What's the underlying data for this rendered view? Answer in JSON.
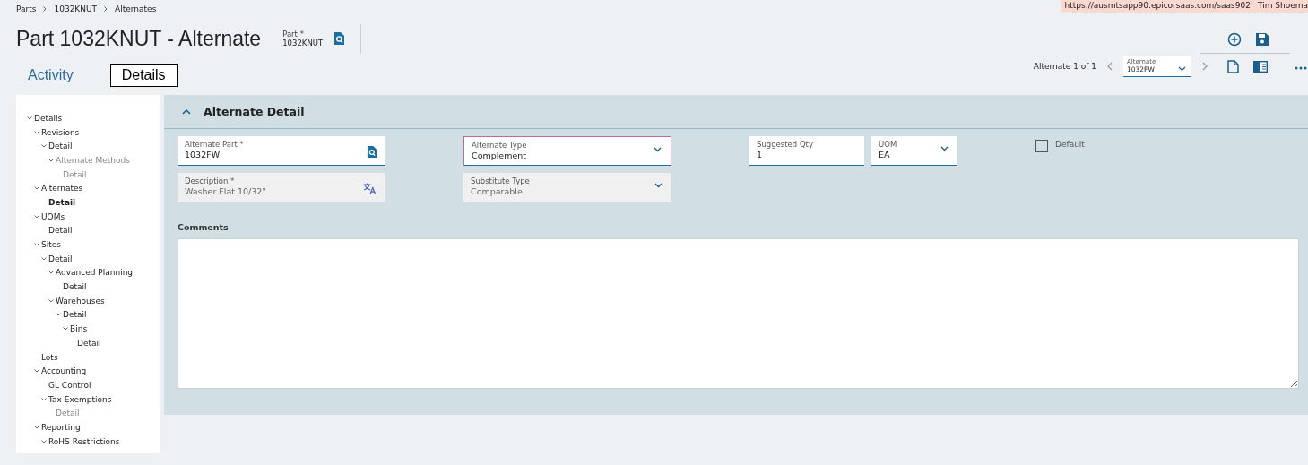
{
  "breadcrumbs": [
    "Parts",
    "1032KNUT",
    "Alternates"
  ],
  "session": {
    "url": "https://ausmtsapp90.epicorsaas.com/saas902",
    "user": "Tim Shoema"
  },
  "title": "Part 1032KNUT - Alternate",
  "part_field": {
    "label": "Part *",
    "value": "1032KNUT"
  },
  "tabs": [
    {
      "label": "Activity",
      "selected": false
    },
    {
      "label": "Details",
      "selected": true
    }
  ],
  "navigator": {
    "text": "Alternate 1 of 1",
    "field": {
      "label": "Alternate",
      "value": "1032FW"
    }
  },
  "tree": [
    {
      "label": "Details",
      "expanded": true,
      "selected": false,
      "disabled": false,
      "children": [
        {
          "label": "Revisions",
          "expanded": true,
          "selected": false,
          "disabled": false,
          "children": [
            {
              "label": "Detail",
              "expanded": true,
              "selected": false,
              "disabled": false,
              "children": [
                {
                  "label": "Alternate Methods",
                  "expanded": true,
                  "selected": false,
                  "disabled": true,
                  "children": [
                    {
                      "label": "Detail",
                      "expanded": false,
                      "selected": false,
                      "disabled": true
                    }
                  ]
                }
              ]
            }
          ]
        },
        {
          "label": "Alternates",
          "expanded": true,
          "selected": false,
          "disabled": false,
          "children": [
            {
              "label": "Detail",
              "expanded": false,
              "selected": true,
              "disabled": false
            }
          ]
        },
        {
          "label": "UOMs",
          "expanded": true,
          "selected": false,
          "disabled": false,
          "children": [
            {
              "label": "Detail",
              "expanded": false,
              "selected": false,
              "disabled": false
            }
          ]
        },
        {
          "label": "Sites",
          "expanded": true,
          "selected": false,
          "disabled": false,
          "children": [
            {
              "label": "Detail",
              "expanded": true,
              "selected": false,
              "disabled": false,
              "children": [
                {
                  "label": "Advanced Planning",
                  "expanded": true,
                  "selected": false,
                  "disabled": false,
                  "children": [
                    {
                      "label": "Detail",
                      "expanded": false,
                      "selected": false,
                      "disabled": false
                    }
                  ]
                },
                {
                  "label": "Warehouses",
                  "expanded": true,
                  "selected": false,
                  "disabled": false,
                  "children": [
                    {
                      "label": "Detail",
                      "expanded": true,
                      "selected": false,
                      "disabled": false,
                      "children": [
                        {
                          "label": "Bins",
                          "expanded": true,
                          "selected": false,
                          "disabled": false,
                          "children": [
                            {
                              "label": "Detail",
                              "expanded": false,
                              "selected": false,
                              "disabled": false
                            }
                          ]
                        }
                      ]
                    }
                  ]
                }
              ]
            }
          ]
        },
        {
          "label": "Lots",
          "expanded": false,
          "selected": false,
          "disabled": false
        },
        {
          "label": "Accounting",
          "expanded": true,
          "selected": false,
          "disabled": false,
          "children": [
            {
              "label": "GL Control",
              "expanded": false,
              "selected": false,
              "disabled": false
            },
            {
              "label": "Tax Exemptions",
              "expanded": true,
              "selected": false,
              "disabled": false,
              "children": [
                {
                  "label": "Detail",
                  "expanded": false,
                  "selected": false,
                  "disabled": true
                }
              ]
            }
          ]
        },
        {
          "label": "Reporting",
          "expanded": true,
          "selected": false,
          "disabled": false,
          "children": [
            {
              "label": "RoHS Restrictions",
              "expanded": true,
              "selected": false,
              "disabled": false
            }
          ]
        }
      ]
    }
  ],
  "panel": {
    "title": "Alternate Detail",
    "expanded": true,
    "fields": [
      {
        "kind": "search",
        "label": "Alternate Part *",
        "value": "1032FW",
        "disabled": false
      },
      {
        "kind": "select",
        "label": "Alternate Type",
        "value": "Complement",
        "disabled": false
      },
      {
        "kind": "text",
        "label": "Suggested Qty",
        "value": "1",
        "disabled": false
      },
      {
        "kind": "select",
        "label": "UOM",
        "value": "EA",
        "disabled": false
      },
      {
        "kind": "checkbox",
        "label": "Default",
        "checked": false
      },
      {
        "kind": "translate",
        "label": "Description *",
        "value": "Washer Flat 10/32\"",
        "disabled": true
      },
      {
        "kind": "select",
        "label": "Substitute Type",
        "value": "Comparable",
        "disabled": true
      }
    ],
    "comments": {
      "label": "Comments"
    }
  }
}
